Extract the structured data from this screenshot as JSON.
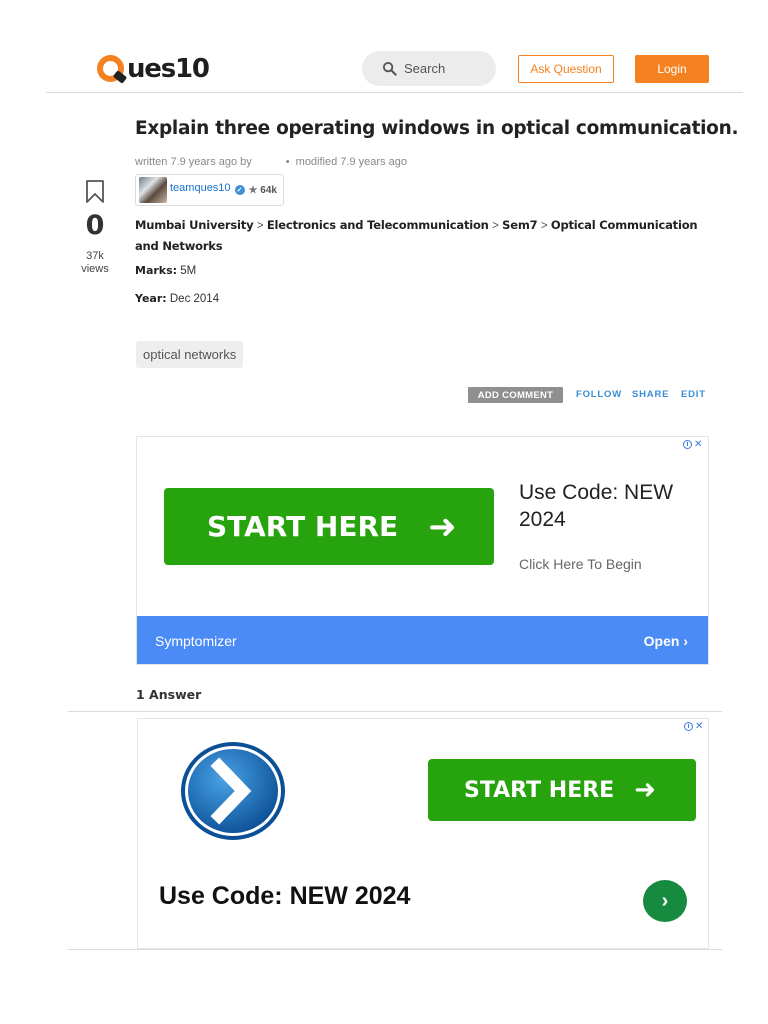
{
  "header": {
    "logo_text": "ues10",
    "search_placeholder": "Search",
    "ask_label": "Ask Question",
    "login_label": "Login"
  },
  "question": {
    "title": "Explain three operating windows in optical communication.",
    "written": "written 7.9 years ago by",
    "modified": "modified 7.9 years ago",
    "author": "teamques10",
    "reputation": "64k",
    "votes": "0",
    "views_count": "37k",
    "views_label": "views",
    "breadcrumbs": [
      "Mumbai University",
      "Electronics and Telecommunication",
      "Sem7",
      "Optical Communication and Networks"
    ],
    "marks_label": "Marks:",
    "marks_value": "5M",
    "year_label": "Year:",
    "year_value": "Dec 2014",
    "tag": "optical networks",
    "actions": {
      "add_comment": "ADD COMMENT",
      "follow": "FOLLOW",
      "share": "SHARE",
      "edit": "EDIT"
    }
  },
  "ad1": {
    "cta": "START HERE",
    "headline": "Use Code: NEW 2024",
    "subtext": "Click Here To Begin",
    "advertiser": "Symptomizer",
    "open_label": "Open"
  },
  "answers_count": "1 Answer",
  "ad2": {
    "cta": "START HERE",
    "headline": "Use Code: NEW 2024"
  },
  "colors": {
    "brand_orange": "#f58220",
    "ad_green": "#26a30d",
    "ad_blue": "#4b8bf5",
    "link_blue": "#3a8fd8"
  }
}
